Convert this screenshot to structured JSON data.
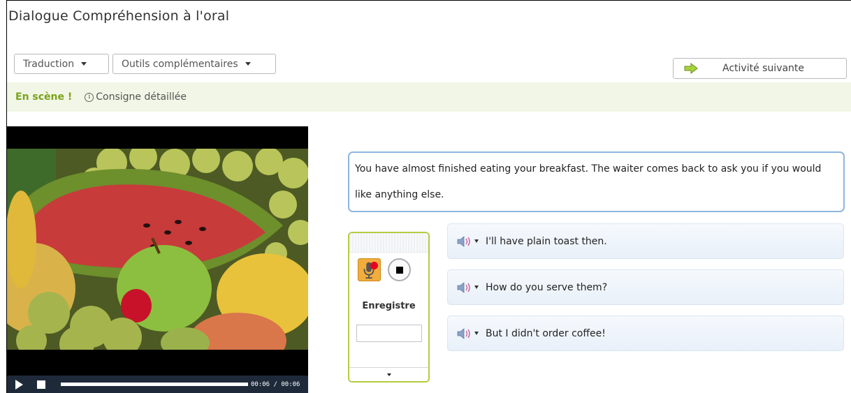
{
  "header": {
    "title": "Dialogue Compréhension à l'oral"
  },
  "toolbar": {
    "translation_label": "Traduction",
    "tools_label": "Outils complémentaires",
    "next_activity_label": "Activité suivante"
  },
  "band": {
    "scene_label": "En scène !",
    "instructions_label": "Consigne détaillée"
  },
  "video": {
    "current_time": "00:06",
    "total_time": "00:06",
    "progress": 1.0
  },
  "prompt": {
    "text": "You have almost finished eating your breakfast. The waiter comes back to ask you if you would like anything else."
  },
  "recorder": {
    "label": "Enregistre",
    "value": ""
  },
  "answers": [
    {
      "text": "I'll have plain toast then."
    },
    {
      "text": "How do you serve them?"
    },
    {
      "text": "But I didn't order coffee!"
    }
  ],
  "colors": {
    "accent_green": "#7aa31a",
    "band_bg": "#f1f6e6",
    "prompt_border": "#8db6de",
    "recorder_border": "#b5cc42",
    "record_dot": "#e8001f"
  }
}
